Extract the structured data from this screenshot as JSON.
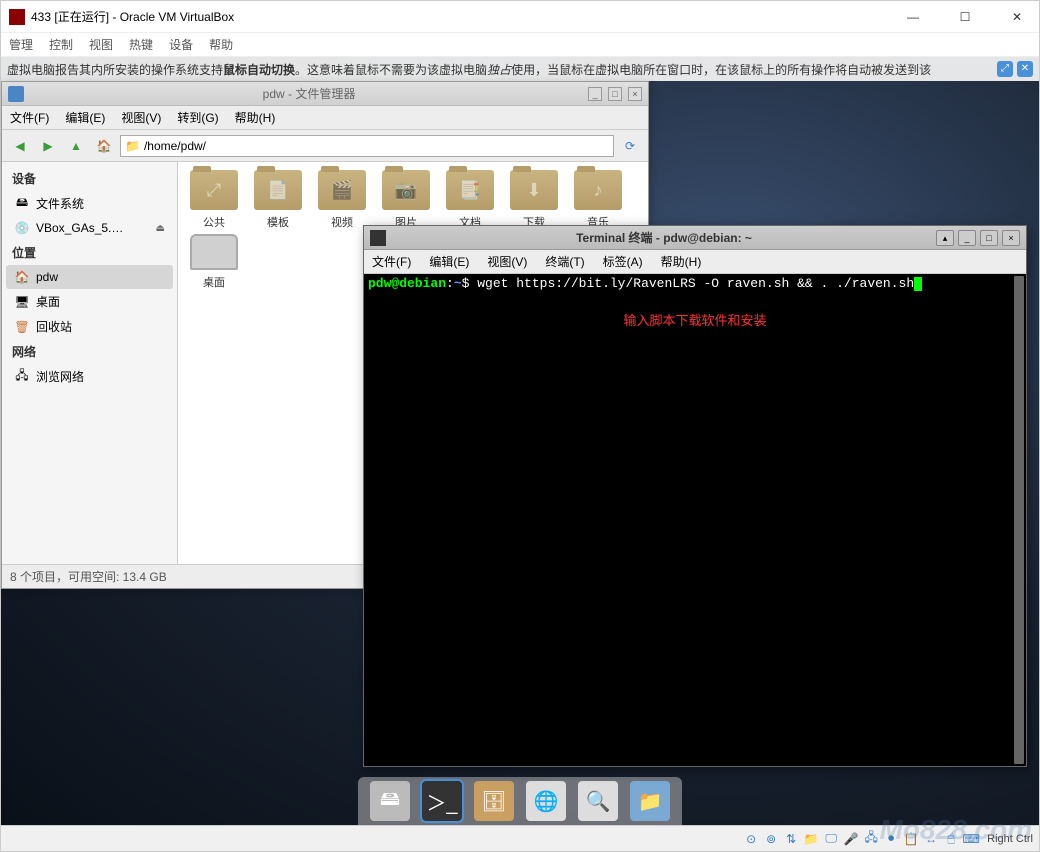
{
  "vbox": {
    "title": "433 [正在运行] - Oracle VM VirtualBox",
    "menu": [
      "管理",
      "控制",
      "视图",
      "热键",
      "设备",
      "帮助"
    ],
    "info_pre": "虚拟电脑报告其内所安装的操作系统支持 ",
    "info_bold": "鼠标自动切换",
    "info_mid": "。这意味着鼠标不需要为该虚拟电脑 ",
    "info_italic": "独占",
    "info_post": " 使用，当鼠标在虚拟电脑所在窗口时，在该鼠标上的所有操作将自动被发送到该",
    "status_right": "Right Ctrl"
  },
  "fm": {
    "title": "pdw - 文件管理器",
    "menu": [
      "文件(F)",
      "编辑(E)",
      "视图(V)",
      "转到(G)",
      "帮助(H)"
    ],
    "path": "/home/pdw/",
    "sections": {
      "devices": "设备",
      "places": "位置",
      "network": "网络"
    },
    "items": {
      "filesystem": "文件系统",
      "vbox_ga": "VBox_GAs_5.…",
      "pdw": "pdw",
      "desktop": "桌面",
      "trash": "回收站",
      "browse": "浏览网络"
    },
    "folders": [
      "公共",
      "模板",
      "视频",
      "图片",
      "文档",
      "下载",
      "音乐",
      "桌面"
    ],
    "status": "8 个项目，可用空间: 13.4 GB"
  },
  "term": {
    "title": "Terminal 终端 - pdw@debian: ~",
    "menu": [
      "文件(F)",
      "编辑(E)",
      "视图(V)",
      "终端(T)",
      "标签(A)",
      "帮助(H)"
    ],
    "prompt_user": "pdw@debian",
    "prompt_path": "~",
    "command": "wget https://bit.ly/RavenLRS -O raven.sh && . ./raven.sh",
    "note": "输入脚本下载软件和安装"
  },
  "watermark": "Mo828.com"
}
